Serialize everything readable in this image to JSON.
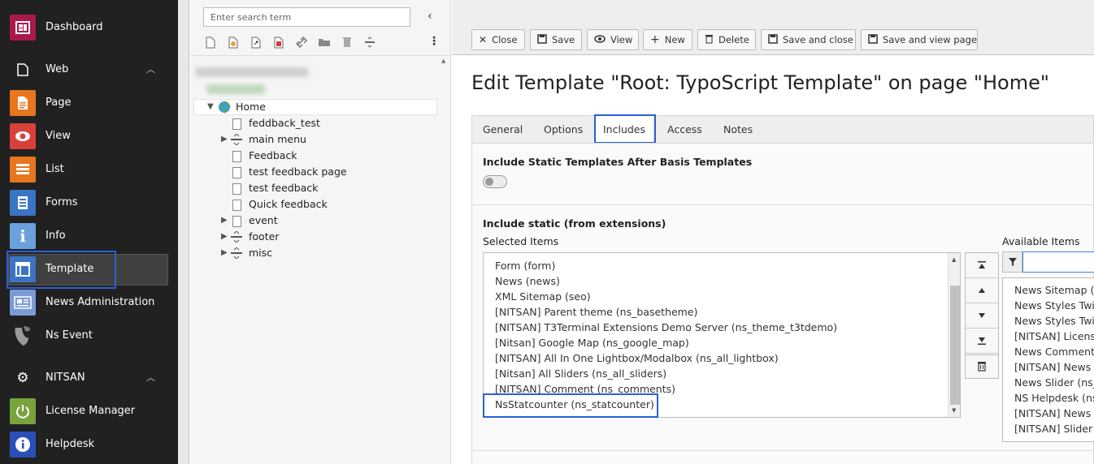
{
  "module_menu": {
    "items": [
      {
        "label": "Dashboard",
        "icon": "dashboard-icon",
        "color": "#a8194e"
      },
      {
        "label": "Web",
        "icon": "web-page-icon",
        "group": true
      },
      {
        "label": "Page",
        "icon": "page-module-icon",
        "color": "#e8761e"
      },
      {
        "label": "View",
        "icon": "eye-icon",
        "color": "#d8403c"
      },
      {
        "label": "List",
        "icon": "list-icon",
        "color": "#e8761e"
      },
      {
        "label": "Forms",
        "icon": "forms-icon",
        "color": "#3c74c4"
      },
      {
        "label": "Info",
        "icon": "info-icon",
        "color": "#6aa0dc"
      },
      {
        "label": "Template",
        "icon": "template-icon",
        "color": "#3c74c4",
        "active": true
      },
      {
        "label": "News Administration",
        "icon": "news-icon",
        "color": "#7a9bd6"
      },
      {
        "label": "Ns Event",
        "icon": "typo3-logo-icon"
      },
      {
        "label": "NITSAN",
        "icon": "gear-icon",
        "group": true
      },
      {
        "label": "License Manager",
        "icon": "power-icon",
        "color": "#78a43c"
      },
      {
        "label": "Helpdesk",
        "icon": "info-circle-icon",
        "color": "#2b4fb8"
      }
    ]
  },
  "page_tree": {
    "search_placeholder": "Enter search term",
    "nodes": [
      {
        "label": "Home",
        "expanded": true,
        "root": true
      },
      {
        "label": "feddback_test"
      },
      {
        "label": "main menu",
        "collapsed": true,
        "type": "separator"
      },
      {
        "label": "Feedback"
      },
      {
        "label": "test feedback page"
      },
      {
        "label": "test feedback"
      },
      {
        "label": "Quick feedback"
      },
      {
        "label": "event",
        "collapsed": true
      },
      {
        "label": "footer",
        "collapsed": true,
        "type": "separator"
      },
      {
        "label": "misc",
        "collapsed": true,
        "type": "separator"
      }
    ]
  },
  "toolbar": {
    "close": "Close",
    "save": "Save",
    "view": "View",
    "new": "New",
    "delete": "Delete",
    "save_close": "Save and close",
    "save_view": "Save and view page"
  },
  "page_title": "Edit Template \"Root: TypoScript Template\" on page \"Home\"",
  "tabs": [
    "General",
    "Options",
    "Includes",
    "Access",
    "Notes"
  ],
  "active_tab": "Includes",
  "includes": {
    "static_after_basis_label": "Include Static Templates After Basis Templates",
    "static_after_basis_enabled": false,
    "include_static_label": "Include static (from extensions)",
    "selected_label": "Selected Items",
    "available_label": "Available Items",
    "selected_items": [
      "Form (form)",
      "News (news)",
      "XML Sitemap (seo)",
      "[NITSAN] Parent theme (ns_basetheme)",
      "[NITSAN] T3Terminal Extensions Demo Server (ns_theme_t3tdemo)",
      "[Nitsan] Google Map (ns_google_map)",
      "[NITSAN] All In One Lightbox/Modalbox (ns_all_lightbox)",
      "[Nitsan] All Sliders (ns_all_sliders)",
      "[NITSAN] Comment (ns_comments)",
      "NsStatcounter (ns_statcounter)"
    ],
    "available_items": [
      "News Sitemap (n",
      "News Styles Twit",
      "News Styles Twit",
      "[NITSAN] Licens",
      "News Comment",
      "[NITSAN] News",
      "News Slider (ns_",
      "NS Helpdesk (ns",
      "[NITSAN] News",
      "[NITSAN] Slider"
    ]
  },
  "colors": {
    "highlight": "#2c5fd6",
    "menu_bg": "#212121"
  }
}
